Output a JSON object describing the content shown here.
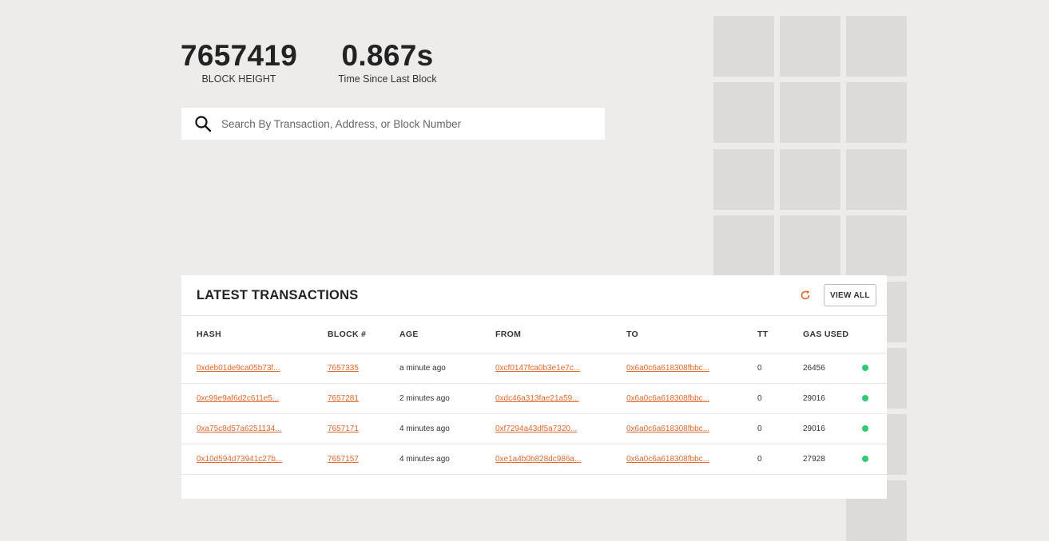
{
  "stats": {
    "block_height": {
      "value": "7657419",
      "label": "BLOCK HEIGHT"
    },
    "time_since": {
      "value": "0.867s",
      "label": "Time Since Last Block"
    }
  },
  "search": {
    "placeholder": "Search By Transaction, Address, or Block Number",
    "icon": "search-icon"
  },
  "transactions": {
    "title": "LATEST TRANSACTIONS",
    "refresh_icon": "refresh-icon",
    "view_all": "VIEW ALL",
    "columns": {
      "hash": "HASH",
      "block": "BLOCK #",
      "age": "AGE",
      "from": "FROM",
      "to": "TO",
      "tt": "TT",
      "gas": "GAS USED"
    },
    "rows": [
      {
        "hash": "0xdeb01de9ca05b73f...",
        "block": "7657335",
        "age": "a minute ago",
        "from": "0xcf0147fca0b3e1e7c...",
        "to": "0x6a0c6a618308fbbc...",
        "tt": "0",
        "gas": "26456",
        "status": "success"
      },
      {
        "hash": "0xc99e9af6d2c611e5...",
        "block": "7657281",
        "age": "2 minutes ago",
        "from": "0xdc46a313fae21a59...",
        "to": "0x6a0c6a618308fbbc...",
        "tt": "0",
        "gas": "29016",
        "status": "success"
      },
      {
        "hash": "0xa75c8d57a6251134...",
        "block": "7657171",
        "age": "4 minutes ago",
        "from": "0xf7294a43df5a7320...",
        "to": "0x6a0c6a618308fbbc...",
        "tt": "0",
        "gas": "29016",
        "status": "success"
      },
      {
        "hash": "0x10d594d73941c27b...",
        "block": "7657157",
        "age": "4 minutes ago",
        "from": "0xe1a4b0b828dc986a...",
        "to": "0x6a0c6a618308fbbc...",
        "tt": "0",
        "gas": "27928",
        "status": "success"
      }
    ]
  },
  "colors": {
    "accent": "#e1682d",
    "success": "#2ecc71",
    "background": "#edecea",
    "tile": "#dcdbd9"
  }
}
